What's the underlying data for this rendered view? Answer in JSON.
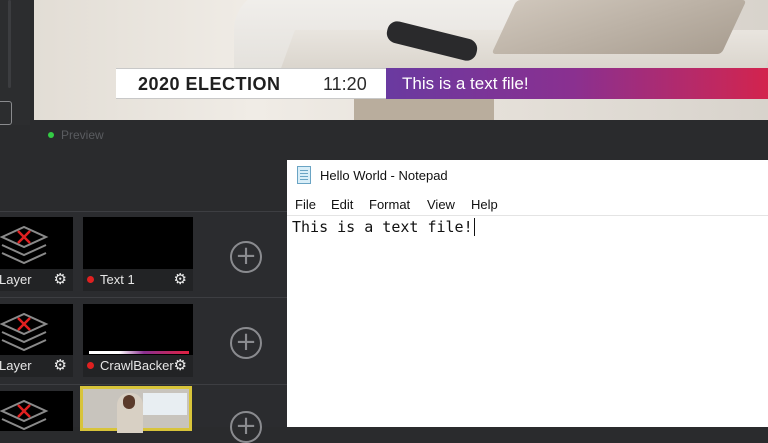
{
  "preview": {
    "lower_third": {
      "title": "2020 ELECTION",
      "time": "11:20",
      "crawl_text": "This is a text file!"
    },
    "label": "Preview",
    "status_color": "#33cc44"
  },
  "sources": {
    "rows": [
      {
        "left_label": "Layer",
        "right_label": "Text 1"
      },
      {
        "left_label": "Layer",
        "right_label": "CrawlBacker"
      },
      {
        "left_label": "",
        "right_label": ""
      }
    ],
    "add_icon": "plus-circle-icon",
    "settings_icon": "gear-icon",
    "live_color": "#e02020",
    "selected_color": "#d8c43a"
  },
  "notepad": {
    "title": "Hello World - Notepad",
    "menu": [
      "File",
      "Edit",
      "Format",
      "View",
      "Help"
    ],
    "content": "This is a text file!"
  }
}
